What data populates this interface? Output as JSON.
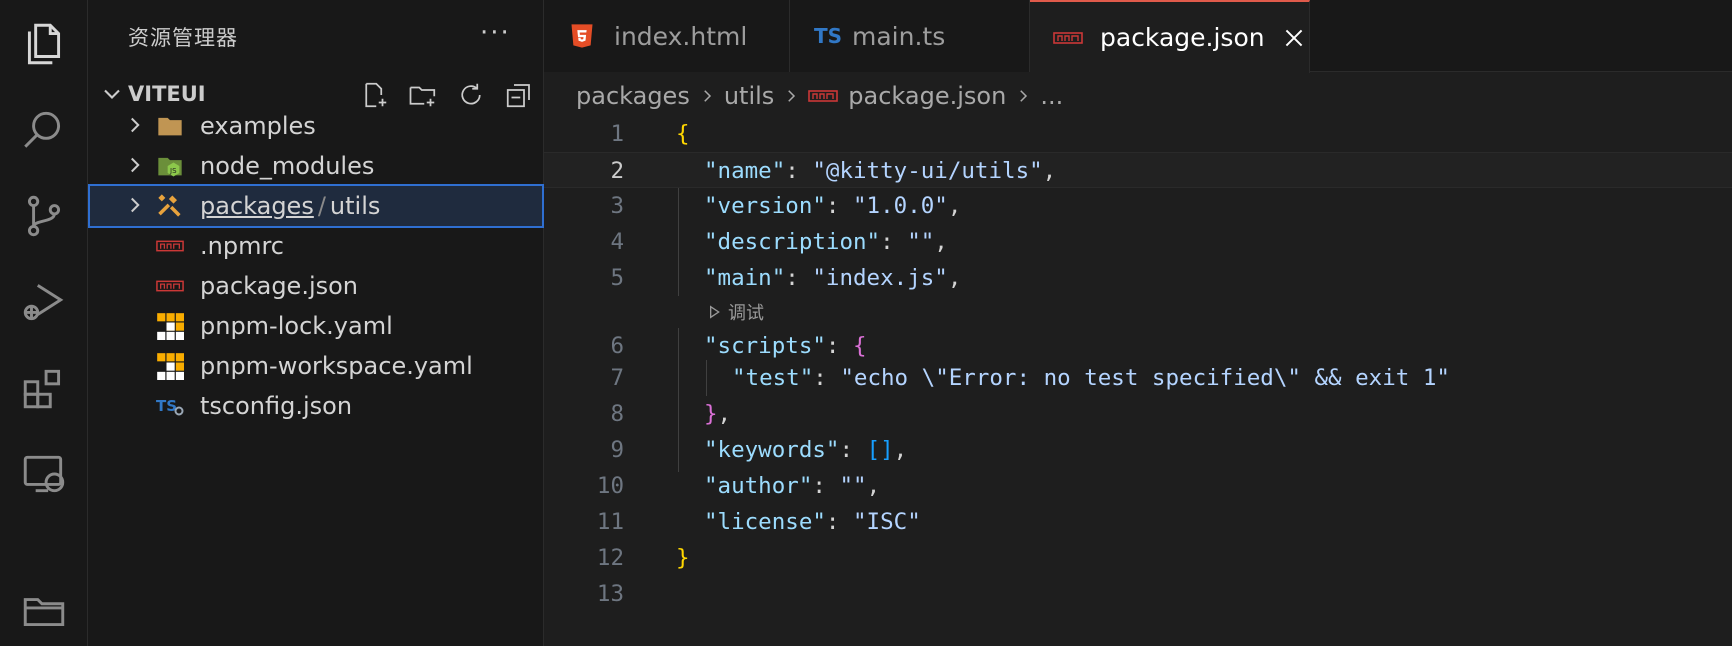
{
  "sidebar": {
    "title": "资源管理器",
    "more": "···",
    "section_label": "VITEUI",
    "items": [
      {
        "label": "examples",
        "icon": "folder-icon",
        "expandable": true
      },
      {
        "label": "node_modules",
        "icon": "node-folder-icon",
        "expandable": true
      },
      {
        "label_a": "packages",
        "sep": "/",
        "label_b": "utils",
        "icon": "tools-folder-icon",
        "expandable": true,
        "selected": true
      },
      {
        "label": ".npmrc",
        "icon": "npm-icon",
        "expandable": false
      },
      {
        "label": "package.json",
        "icon": "npm-icon",
        "expandable": false
      },
      {
        "label": "pnpm-lock.yaml",
        "icon": "pnpm-icon",
        "expandable": false
      },
      {
        "label": "pnpm-workspace.yaml",
        "icon": "pnpm-icon",
        "expandable": false
      },
      {
        "label": "tsconfig.json",
        "icon": "tsconfig-icon",
        "expandable": false
      }
    ]
  },
  "tabs": [
    {
      "label": "index.html",
      "icon": "html5-icon",
      "active": false
    },
    {
      "label": "main.ts",
      "icon": "typescript-icon",
      "badge": "TS",
      "active": false
    },
    {
      "label": "package.json",
      "icon": "npm-icon",
      "active": true
    }
  ],
  "breadcrumb": {
    "parts": [
      "packages",
      "utils",
      "package.json",
      "..."
    ]
  },
  "codelens": "调试",
  "code": {
    "current_line": 2,
    "line_numbers": [
      "1",
      "2",
      "3",
      "4",
      "5",
      "6",
      "7",
      "8",
      "9",
      "10",
      "11",
      "12",
      "13"
    ],
    "lines": {
      "l1_open": "{",
      "l2_key": "\"name\"",
      "l2_val": "\"@kitty-ui/utils\"",
      "l3_key": "\"version\"",
      "l3_val": "\"1.0.0\"",
      "l4_key": "\"description\"",
      "l4_val": "\"\"",
      "l5_key": "\"main\"",
      "l5_val": "\"index.js\"",
      "l6_key": "\"scripts\"",
      "l6_open": "{",
      "l7_key": "\"test\"",
      "l7_val": "\"echo \\\"Error: no test specified\\\" && exit 1\"",
      "l8_close": "}",
      "l9_key": "\"keywords\"",
      "l9_val": "[]",
      "l10_key": "\"author\"",
      "l10_val": "\"\"",
      "l11_key": "\"license\"",
      "l11_val": "\"ISC\"",
      "l12_close": "}"
    }
  },
  "colors": {
    "accent_tab_border": "#e05b4b",
    "selection_border": "#2f6fd1",
    "json_key": "#9cdcfe",
    "json_string": "#ce9178"
  }
}
